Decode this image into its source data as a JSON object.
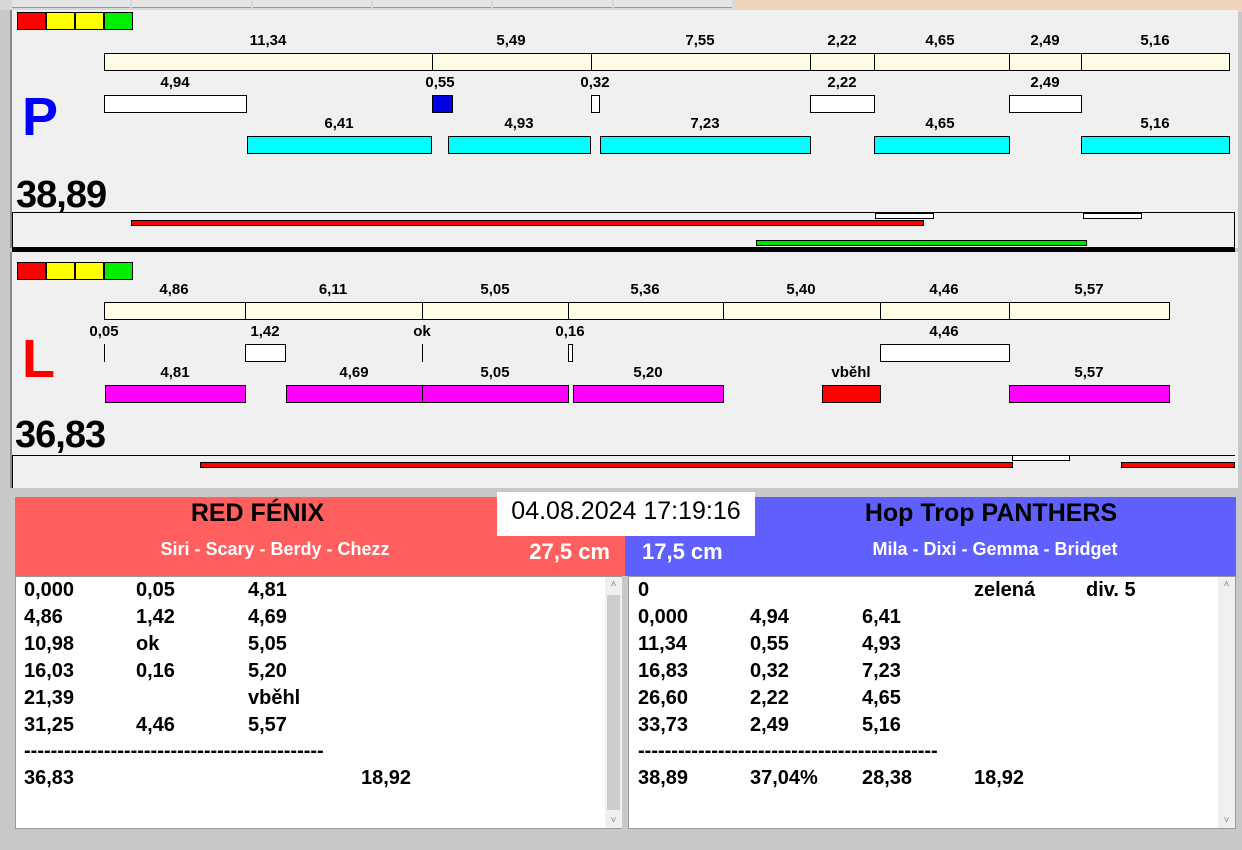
{
  "colors": {
    "indicator": [
      "#ff0000",
      "#ffff00",
      "#ffff00",
      "#00e000"
    ],
    "team_red": "#ff5f5f",
    "team_blue": "#6060ff"
  },
  "P": {
    "letter": "P",
    "total": "38,89",
    "row1": [
      "11,34",
      "5,49",
      "7,55",
      "2,22",
      "4,65",
      "2,49",
      "5,16"
    ],
    "row2": [
      "4,94",
      "0,55",
      "0,32",
      "2,22",
      "2,49"
    ],
    "row3": [
      "6,41",
      "4,93",
      "7,23",
      "4,65",
      "5,16"
    ]
  },
  "L": {
    "letter": "L",
    "total": "36,83",
    "row1": [
      "4,86",
      "6,11",
      "5,05",
      "5,36",
      "5,40",
      "4,46",
      "5,57"
    ],
    "row2": [
      "0,05",
      "1,42",
      "ok",
      "0,16",
      "4,46"
    ],
    "row3": [
      "4,81",
      "4,69",
      "5,05",
      "5,20",
      "vběhl",
      "5,57"
    ]
  },
  "datetime": "04.08.2024 17:19:16",
  "left_team": {
    "name": "RED FÉNIX",
    "members": "Siri - Scary - Berdy - Chezz",
    "cm": "27,5 cm",
    "rows": [
      [
        "0,000",
        "0,05",
        "4,81"
      ],
      [
        "4,86",
        "1,42",
        "4,69"
      ],
      [
        "10,98",
        "ok",
        "5,05"
      ],
      [
        "16,03",
        "0,16",
        "5,20"
      ],
      [
        "21,39",
        "",
        "vběhl"
      ],
      [
        "31,25",
        "4,46",
        "5,57"
      ]
    ],
    "separator": "---------------------------------------------",
    "summary": [
      "36,83",
      "18,92"
    ]
  },
  "right_team": {
    "name": "Hop Trop PANTHERS",
    "members": "Mila - Dixi - Gemma - Bridget",
    "cm": "17,5 cm",
    "header": [
      "0",
      "zelená",
      "div. 5"
    ],
    "rows": [
      [
        "0,000",
        "4,94",
        "6,41"
      ],
      [
        "11,34",
        "0,55",
        "4,93"
      ],
      [
        "16,83",
        "0,32",
        "7,23"
      ],
      [
        "26,60",
        "2,22",
        "4,65"
      ],
      [
        "33,73",
        "2,49",
        "5,16"
      ]
    ],
    "separator": "---------------------------------------------",
    "summary": [
      "38,89",
      "37,04%",
      "28,38",
      "18,92"
    ]
  }
}
